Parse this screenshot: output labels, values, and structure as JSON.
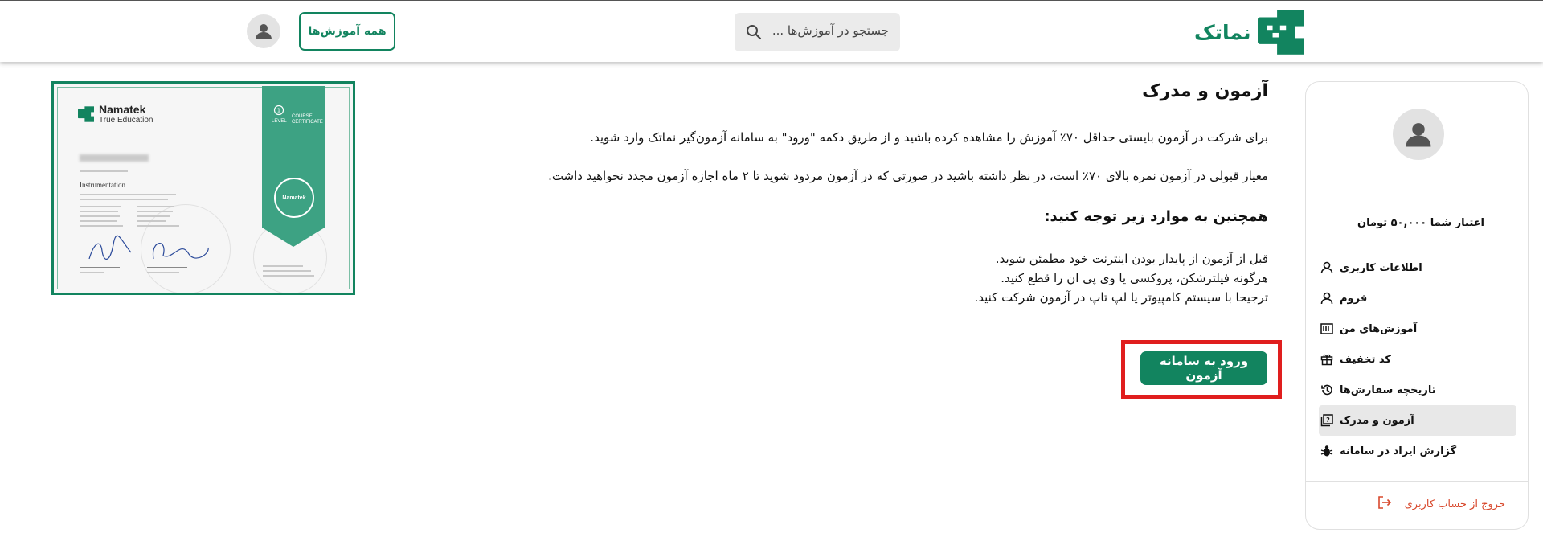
{
  "header": {
    "logo_text": "نماتک",
    "search_placeholder": "جستجو در آموزش‌ها ...",
    "all_courses_label": "همه آموزش‌ها"
  },
  "sidebar": {
    "credit_text": "اعتبار شما ۵۰,۰۰۰ تومان",
    "items": [
      {
        "label": "اطلاعات کاربری",
        "icon": "user-icon"
      },
      {
        "label": "فروم",
        "icon": "user-icon"
      },
      {
        "label": "آموزش‌های من",
        "icon": "courses-icon"
      },
      {
        "label": "کد تخفیف",
        "icon": "gift-icon"
      },
      {
        "label": "تاریخچه سفارش‌ها",
        "icon": "history-icon"
      },
      {
        "label": "آزمون و مدرک",
        "icon": "exam-icon",
        "active": true
      },
      {
        "label": "گزارش ایراد در سامانه",
        "icon": "bug-icon"
      }
    ],
    "logout_label": "خروج از حساب کاربری"
  },
  "main": {
    "title": "آزمون و مدرک",
    "paragraph_1": "برای شرکت در آزمون بایستی حداقل ۷۰٪ آموزش را مشاهده کرده باشید و از طریق دکمه \"ورود\" به سامانه آزمون‌گیر نماتک وارد شوید.",
    "paragraph_2": "معیار قبولی در آزمون نمره بالای ۷۰٪ است، در نظر داشته باشید در صورتی که در آزمون مردود شوید تا ۲ ماه اجازه آزمون مجدد نخواهید داشت.",
    "subtitle": "همچنین به موارد زیر توجه کنید:",
    "notes": [
      "قبل از آزمون از پایدار بودن اینترنت خود مطمئن شوید.",
      "هرگونه فیلترشکن، پروکسی یا وی پی ان را قطع کنید.",
      "ترجیحا با سیستم کامپیوتر یا لپ تاپ در آزمون شرکت کنید."
    ],
    "exam_button_label": "ورود به سامانه آزمون"
  },
  "certificate": {
    "brand_name": "Namatek",
    "brand_tagline": "True Education",
    "course": "Instrumentation",
    "level": "LEVEL",
    "badge_line1": "COURSE",
    "badge_line2": "CERTIFICATE",
    "seal_text": "Namatek"
  },
  "colors": {
    "brand_green": "#12845f",
    "highlight_red": "#e01e1e",
    "logout_red": "#d8482c"
  }
}
